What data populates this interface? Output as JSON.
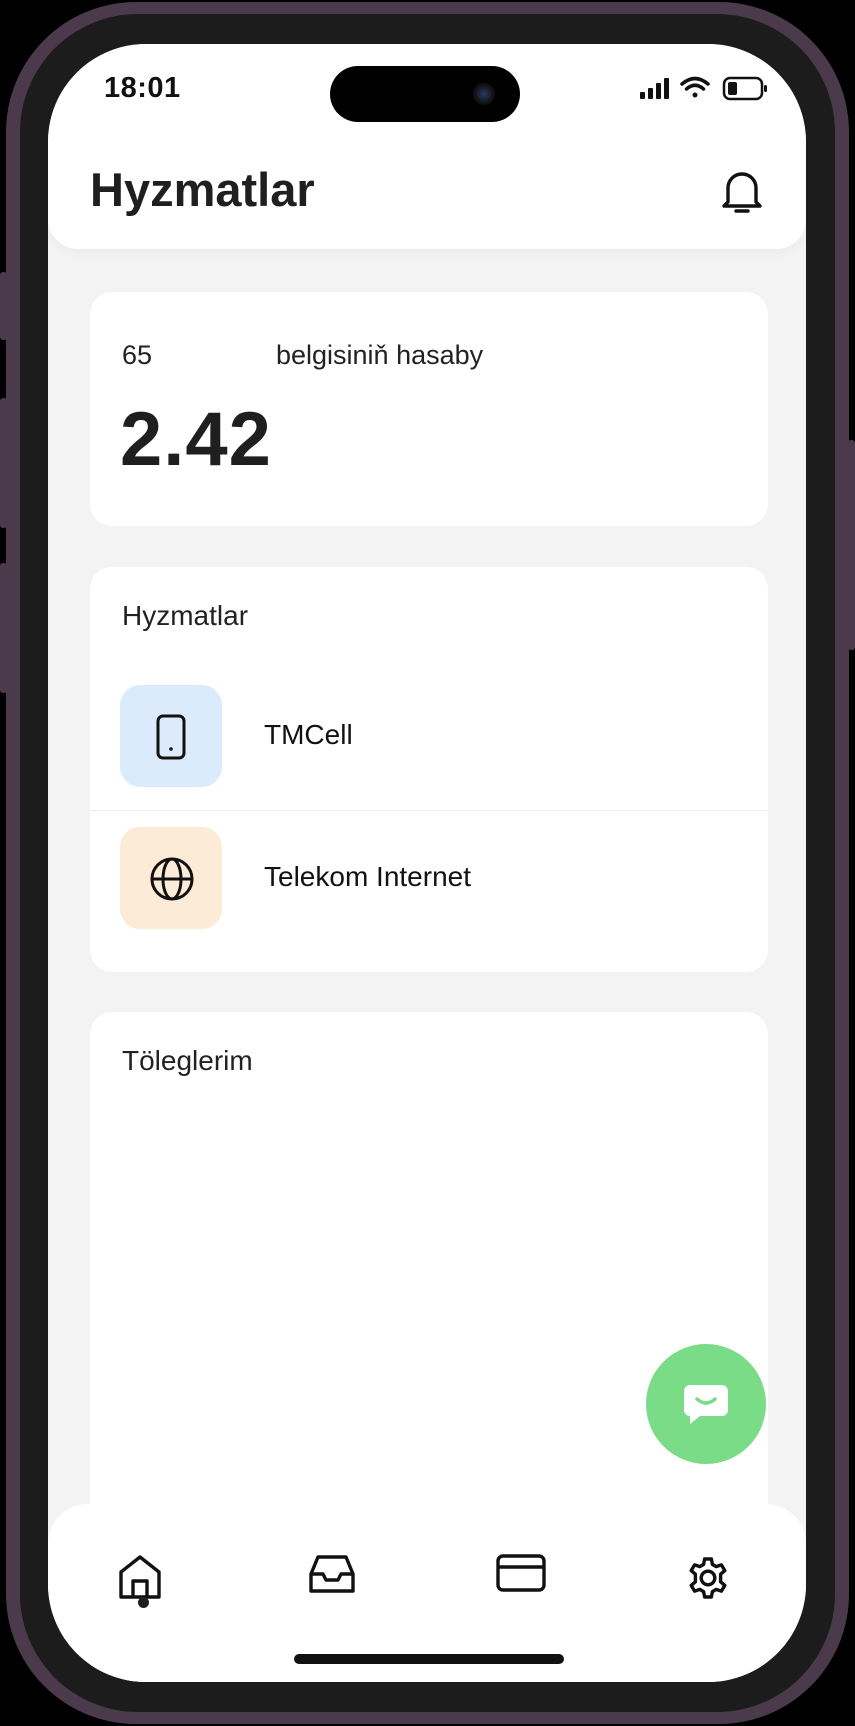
{
  "status_bar": {
    "time": "18:01"
  },
  "header": {
    "title": "Hyzmatlar",
    "bell_icon": "bell-icon"
  },
  "balance": {
    "phone_number": "65",
    "label": "belgisiniň hasaby",
    "value": "2.42"
  },
  "services": {
    "title": "Hyzmatlar",
    "items": [
      {
        "label": "TMCell",
        "icon": "smartphone-icon",
        "bg_color": "#dcebfb"
      },
      {
        "label": "Telekom Internet",
        "icon": "globe-icon",
        "bg_color": "#fcebd6"
      }
    ]
  },
  "payments": {
    "title": "Töleglerim"
  },
  "fab": {
    "icon": "chat-icon",
    "color": "#7bdc88"
  },
  "bottom_nav": {
    "items": [
      {
        "icon": "home-icon",
        "active": true
      },
      {
        "icon": "inbox-icon",
        "active": false
      },
      {
        "icon": "card-icon",
        "active": false
      },
      {
        "icon": "gear-icon",
        "active": false
      }
    ]
  }
}
